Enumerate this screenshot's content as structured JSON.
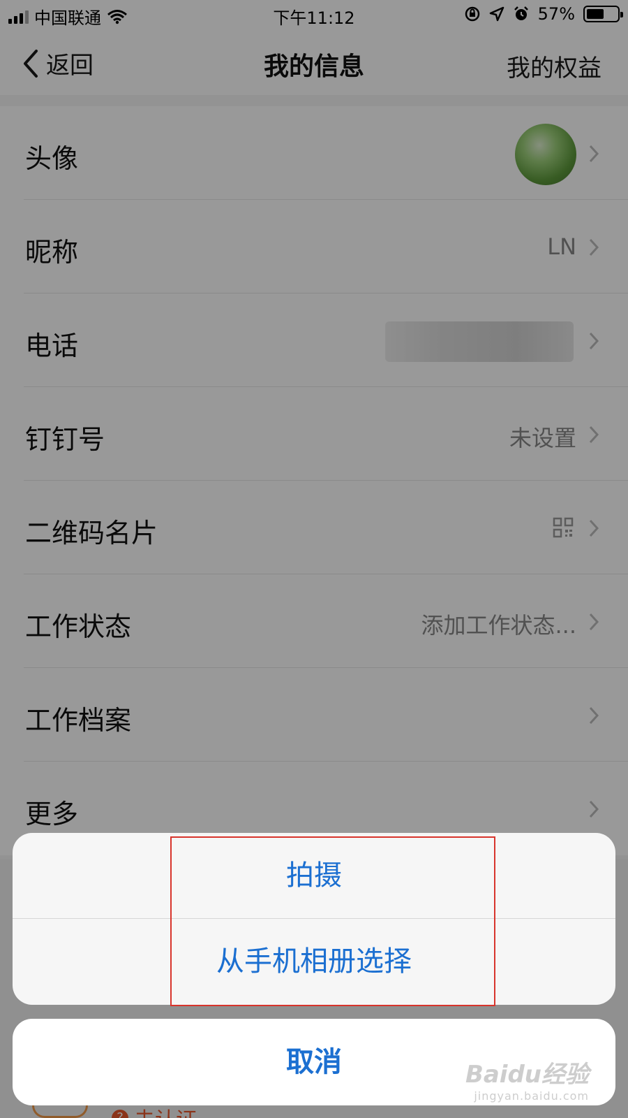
{
  "status_bar": {
    "carrier": "中国联通",
    "time": "下午11:12",
    "battery_percent": "57%",
    "battery_level": 0.57
  },
  "nav": {
    "back_label": "返回",
    "title": "我的信息",
    "right_label": "我的权益"
  },
  "rows": [
    {
      "label": "头像",
      "value": ""
    },
    {
      "label": "昵称",
      "value": "LN"
    },
    {
      "label": "电话",
      "value": ""
    },
    {
      "label": "钉钉号",
      "value": "未设置"
    },
    {
      "label": "二维码名片",
      "value": ""
    },
    {
      "label": "工作状态",
      "value": "添加工作状态..."
    },
    {
      "label": "工作档案",
      "value": ""
    },
    {
      "label": "更多",
      "value": ""
    }
  ],
  "background_fragment": {
    "cert_label": "未认证"
  },
  "action_sheet": {
    "take_photo": "拍摄",
    "choose_album": "从手机相册选择",
    "cancel": "取消"
  },
  "watermark": {
    "main": "Baidu经验",
    "sub": "jingyan.baidu.com"
  },
  "colors": {
    "action_blue": "#1b6fd1",
    "highlight_red": "#d8342c",
    "cert_orange": "#e8552a"
  }
}
